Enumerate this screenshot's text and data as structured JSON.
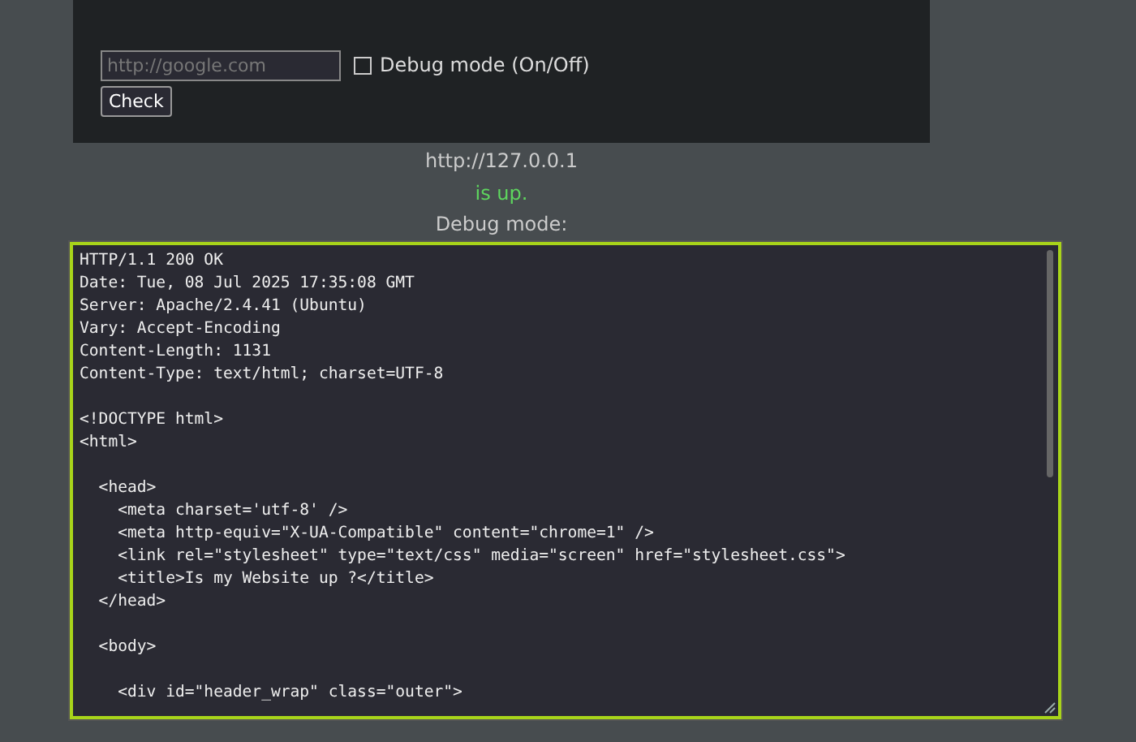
{
  "form": {
    "url_field": {
      "placeholder": "http://google.com"
    },
    "debug_checkbox": {
      "label": "Debug mode (On/Off)",
      "checked": false
    },
    "button": "Check"
  },
  "result": {
    "url": "http://127.0.0.1",
    "status": "is up.",
    "debug_label": "Debug mode:"
  },
  "response_box": {
    "content": "HTTP/1.1 200 OK\nDate: Tue, 08 Jul 2025 17:35:08 GMT\nServer: Apache/2.4.41 (Ubuntu)\nVary: Accept-Encoding\nContent-Length: 1131\nContent-Type: text/html; charset=UTF-8\n\n<!DOCTYPE html>\n<html>\n\n  <head>\n    <meta charset='utf-8' />\n    <meta http-equiv=\"X-UA-Compatible\" content=\"chrome=1\" />\n    <link rel=\"stylesheet\" type=\"text/css\" media=\"screen\" href=\"stylesheet.css\">\n    <title>Is my Website up ?</title>\n  </head>\n\n  <body>\n\n    <div id=\"header_wrap\" class=\"outer\">"
  }
}
